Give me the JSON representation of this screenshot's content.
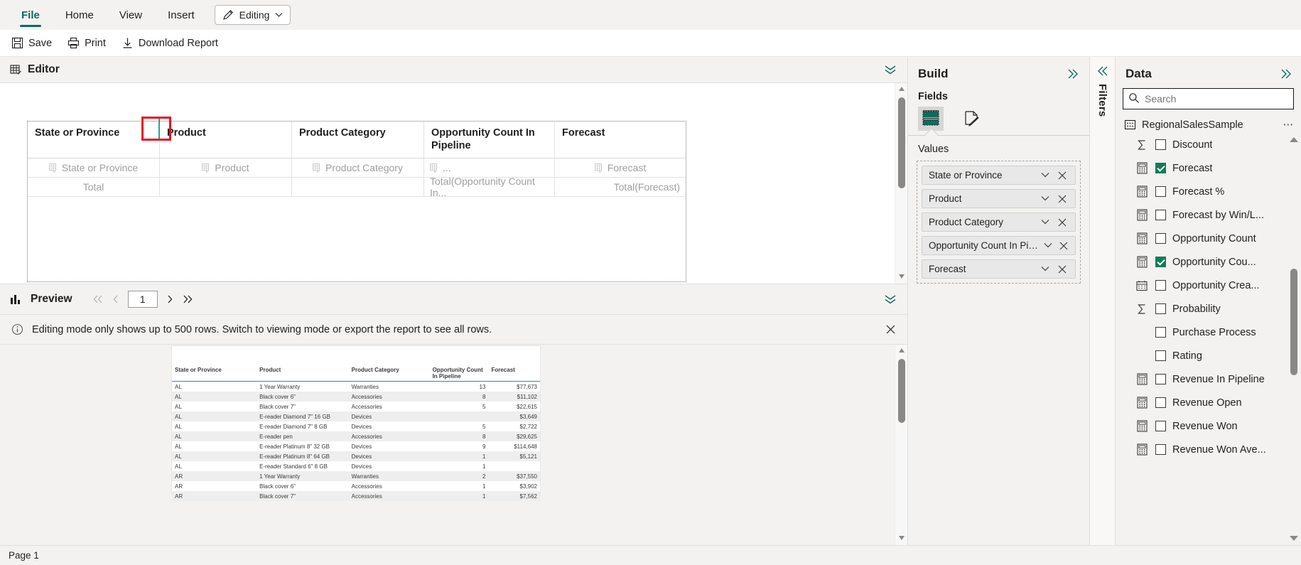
{
  "ribbon": {
    "tabs": [
      {
        "label": "File",
        "active": true
      },
      {
        "label": "Home",
        "active": false
      },
      {
        "label": "View",
        "active": false
      },
      {
        "label": "Insert",
        "active": false
      }
    ],
    "mode_chip": {
      "label": "Editing",
      "icon": "pencil-icon",
      "chevron": "chevron-down-icon"
    },
    "actions": [
      {
        "label": "Save",
        "icon": "save-icon"
      },
      {
        "label": "Print",
        "icon": "print-icon"
      },
      {
        "label": "Download Report",
        "icon": "download-icon"
      }
    ]
  },
  "editor": {
    "title": "Editor",
    "icon": "table-edit-icon",
    "collapse_icon": "chevron-double-down-icon",
    "table": {
      "headers": [
        "State or Province",
        "Product",
        "Product Category",
        "Opportunity Count In Pipeline",
        "Forecast"
      ],
      "placeholders": [
        "State or Province",
        "Product",
        "Product Category",
        "...",
        "Forecast"
      ],
      "totals": [
        "Total",
        "",
        "",
        "Total(Opportunity Count In...",
        "Total(Forecast)"
      ]
    }
  },
  "preview": {
    "title": "Preview",
    "icon": "chart-icon",
    "collapse_icon": "chevron-double-down-icon",
    "pager": {
      "first": "first-page-icon",
      "prev": "prev-page-icon",
      "page_value": "1",
      "next": "next-page-icon",
      "last": "last-page-icon"
    },
    "info_message": "Editing mode only shows up to 500 rows. Switch to viewing mode or export the report to see all rows.",
    "info_icon": "info-icon",
    "close_icon": "close-icon",
    "report": {
      "columns": [
        "State or Province",
        "Product",
        "Product Category",
        "Opportunity Count In Pipeline",
        "Forecast"
      ],
      "rows": [
        [
          "AL",
          "1 Year Warranty",
          "Warranties",
          "13",
          "$77,673"
        ],
        [
          "AL",
          "Black cover 6\"",
          "Accessories",
          "8",
          "$11,102"
        ],
        [
          "AL",
          "Black cover 7\"",
          "Accessories",
          "5",
          "$22,615"
        ],
        [
          "AL",
          "E-reader Diamond 7\" 16 GB",
          "Devices",
          "",
          "$3,649"
        ],
        [
          "AL",
          "E-reader Diamond 7\" 8 GB",
          "Devices",
          "5",
          "$2,722"
        ],
        [
          "AL",
          "E-reader pen",
          "Accessories",
          "8",
          "$29,625"
        ],
        [
          "AL",
          "E-reader Platinum 8\" 32 GB",
          "Devices",
          "9",
          "$114,648"
        ],
        [
          "AL",
          "E-reader Platinum 8\" 64 GB",
          "Devices",
          "1",
          "$5,121"
        ],
        [
          "AL",
          "E-reader Standard 6\" 8 GB",
          "Devices",
          "1",
          ""
        ],
        [
          "AR",
          "1 Year Warranty",
          "Warranties",
          "2",
          "$37,550"
        ],
        [
          "AR",
          "Black cover 6\"",
          "Accessories",
          "1",
          "$3,902"
        ],
        [
          "AR",
          "Black cover 7\"",
          "Accessories",
          "1",
          "$7,562"
        ]
      ]
    }
  },
  "build": {
    "title": "Build",
    "expand_icon": "chevron-double-right-icon",
    "fields_label": "Fields",
    "visual_icons": [
      {
        "name": "table-visual-icon",
        "selected": true
      },
      {
        "name": "format-paint-icon",
        "selected": false
      }
    ],
    "values_label": "Values",
    "values": [
      {
        "label": "State or Province",
        "chevron": "chevron-down-icon",
        "remove": "close-icon"
      },
      {
        "label": "Product",
        "chevron": "chevron-down-icon",
        "remove": "close-icon"
      },
      {
        "label": "Product Category",
        "chevron": "chevron-down-icon",
        "remove": "close-icon"
      },
      {
        "label": "Opportunity Count In Pipeline",
        "chevron": "chevron-down-icon",
        "remove": "close-icon"
      },
      {
        "label": "Forecast",
        "chevron": "chevron-down-icon",
        "remove": "close-icon"
      }
    ]
  },
  "filters": {
    "label": "Filters",
    "collapse_icon": "chevron-double-left-icon"
  },
  "data": {
    "title": "Data",
    "expand_icon": "chevron-double-right-icon",
    "search": {
      "value": "",
      "placeholder": "Search",
      "icon": "search-icon"
    },
    "dataset": {
      "name": "RegionalSalesSample",
      "icon": "dataset-icon",
      "menu": "more-options-icon"
    },
    "fields": [
      {
        "label": "Discount",
        "checked": false,
        "icon": "sigma-icon"
      },
      {
        "label": "Forecast",
        "checked": true,
        "icon": "measure-icon"
      },
      {
        "label": "Forecast %",
        "checked": false,
        "icon": "measure-icon"
      },
      {
        "label": "Forecast by Win/L...",
        "checked": false,
        "icon": "measure-icon"
      },
      {
        "label": "Opportunity Count",
        "checked": false,
        "icon": "measure-icon"
      },
      {
        "label": "Opportunity Cou...",
        "checked": true,
        "icon": "measure-icon"
      },
      {
        "label": "Opportunity Crea...",
        "checked": false,
        "icon": "calendar-icon"
      },
      {
        "label": "Probability",
        "checked": false,
        "icon": "sigma-icon"
      },
      {
        "label": "Purchase Process",
        "checked": false,
        "icon": "none"
      },
      {
        "label": "Rating",
        "checked": false,
        "icon": "none"
      },
      {
        "label": "Revenue In Pipeline",
        "checked": false,
        "icon": "measure-icon"
      },
      {
        "label": "Revenue Open",
        "checked": false,
        "icon": "measure-icon"
      },
      {
        "label": "Revenue Won",
        "checked": false,
        "icon": "measure-icon"
      },
      {
        "label": "Revenue Won Ave...",
        "checked": false,
        "icon": "measure-icon"
      }
    ]
  },
  "statusbar": {
    "page_label": "Page 1"
  },
  "colors": {
    "accent": "#0f6b5c",
    "checkbox_on": "#107c5a",
    "highlight_box": "#e81123",
    "resize_bar": "#2aa198",
    "panel_bg": "#f3f2f1"
  }
}
